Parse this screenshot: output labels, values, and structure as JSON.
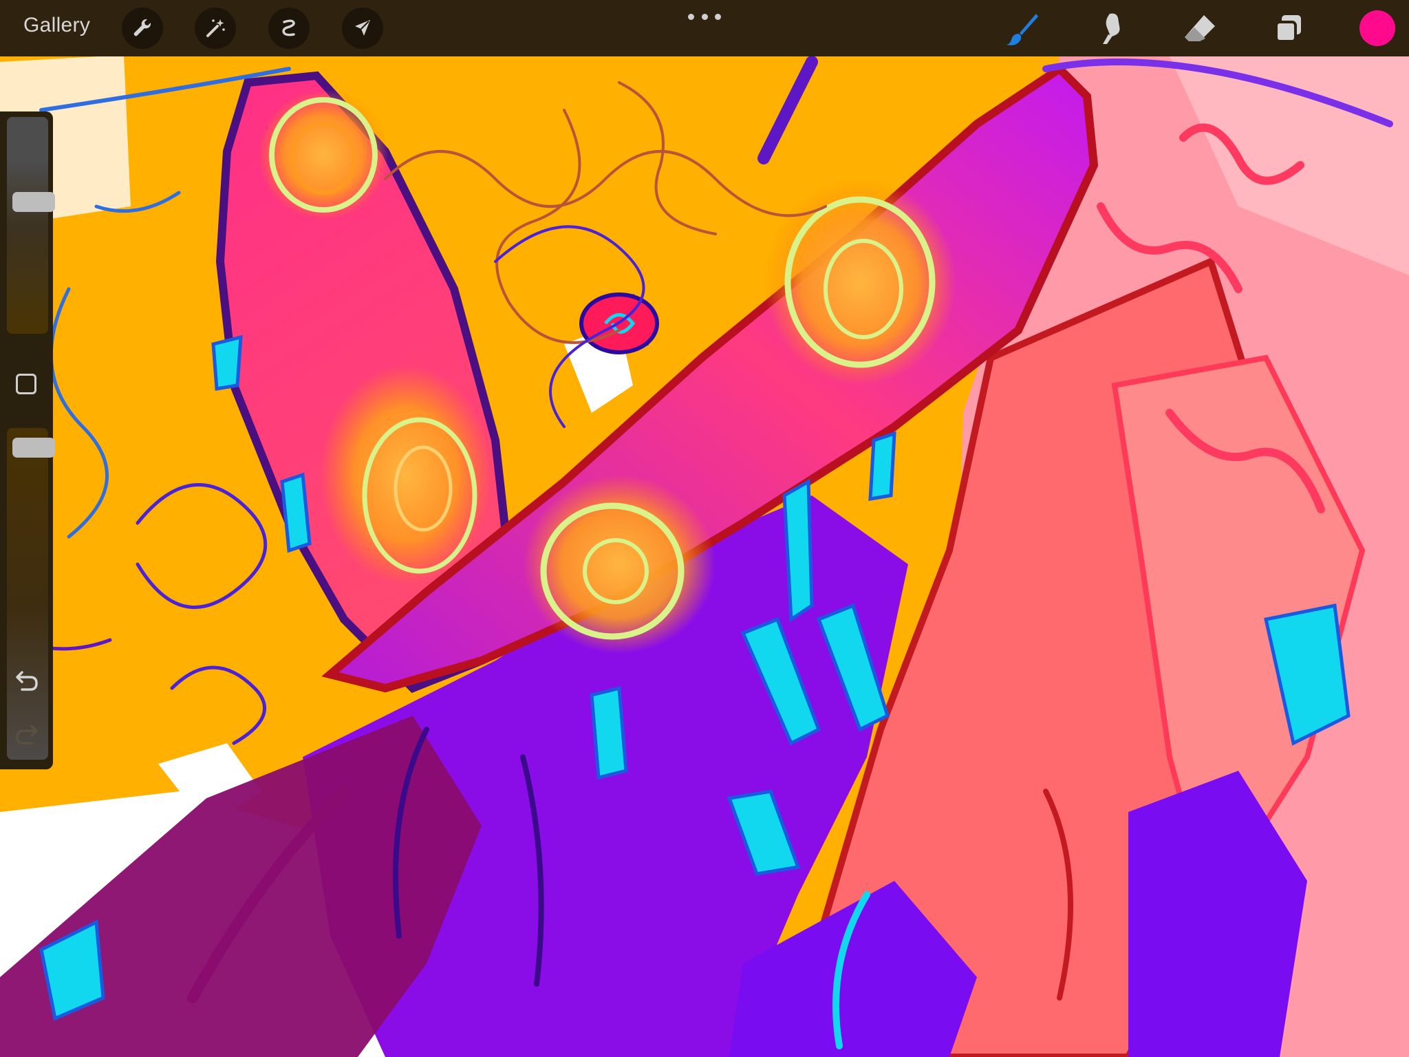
{
  "toolbar": {
    "gallery_label": "Gallery",
    "left_tools": [
      {
        "name": "actions",
        "icon": "wrench-icon"
      },
      {
        "name": "adjustments",
        "icon": "magic-wand-icon"
      },
      {
        "name": "selection",
        "icon": "selection-icon"
      },
      {
        "name": "transform",
        "icon": "arrow-cursor-icon"
      }
    ],
    "more_icon": "more-dots-icon",
    "right_tools": [
      {
        "name": "brush",
        "icon": "brush-icon",
        "active": true
      },
      {
        "name": "smudge",
        "icon": "smudge-icon",
        "active": false
      },
      {
        "name": "eraser",
        "icon": "eraser-icon",
        "active": false
      },
      {
        "name": "layers",
        "icon": "layers-icon",
        "active": false
      }
    ],
    "current_color": "#ff0a8c"
  },
  "sidebar": {
    "brush_size_level": 0.62,
    "brush_opacity_level": 0.97,
    "modify_icon": "square-icon",
    "undo_icon": "undo-icon",
    "redo_icon": "redo-icon",
    "redo_enabled": false
  },
  "colors": {
    "toolbar_bg": "#2f230f",
    "sidebar_bg": "#2a200e",
    "active_tool": "#1f7fe0",
    "inactive_tool": "#d4d4d4",
    "canvas_orange": "#ffb000",
    "canvas_magenta": "#ff2e88",
    "canvas_purple": "#7a0cf2",
    "canvas_cyan": "#12d8ef",
    "canvas_pink": "#ff9aa8"
  }
}
